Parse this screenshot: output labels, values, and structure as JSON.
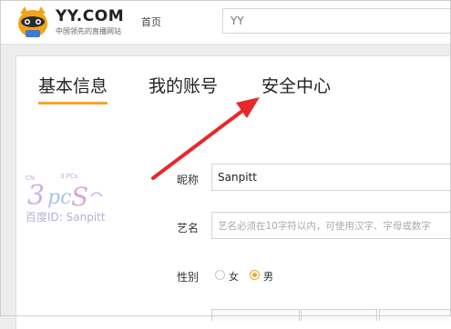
{
  "header": {
    "logo_text": "YY.COM",
    "logo_subtitle": "中国领先的直播网站",
    "nav_home": "首页",
    "search_placeholder": "YY"
  },
  "tabs": [
    {
      "label": "基本信息",
      "active": true
    },
    {
      "label": "我的账号",
      "active": false
    },
    {
      "label": "安全中心",
      "active": false
    }
  ],
  "watermark": {
    "text": "百度ID: Sanpitt"
  },
  "form": {
    "nickname_label": "昵称",
    "nickname_value": "Sanpitt",
    "stage_name_label": "艺名",
    "stage_name_placeholder": "艺名必须在10字符以内，可使用汉字、字母或数字",
    "gender_label": "性别",
    "gender_options": [
      "女",
      "男"
    ],
    "gender_selected": "男"
  },
  "colors": {
    "accent": "#f5a623",
    "arrow": "#e8282b",
    "page_bg": "#ededed"
  }
}
